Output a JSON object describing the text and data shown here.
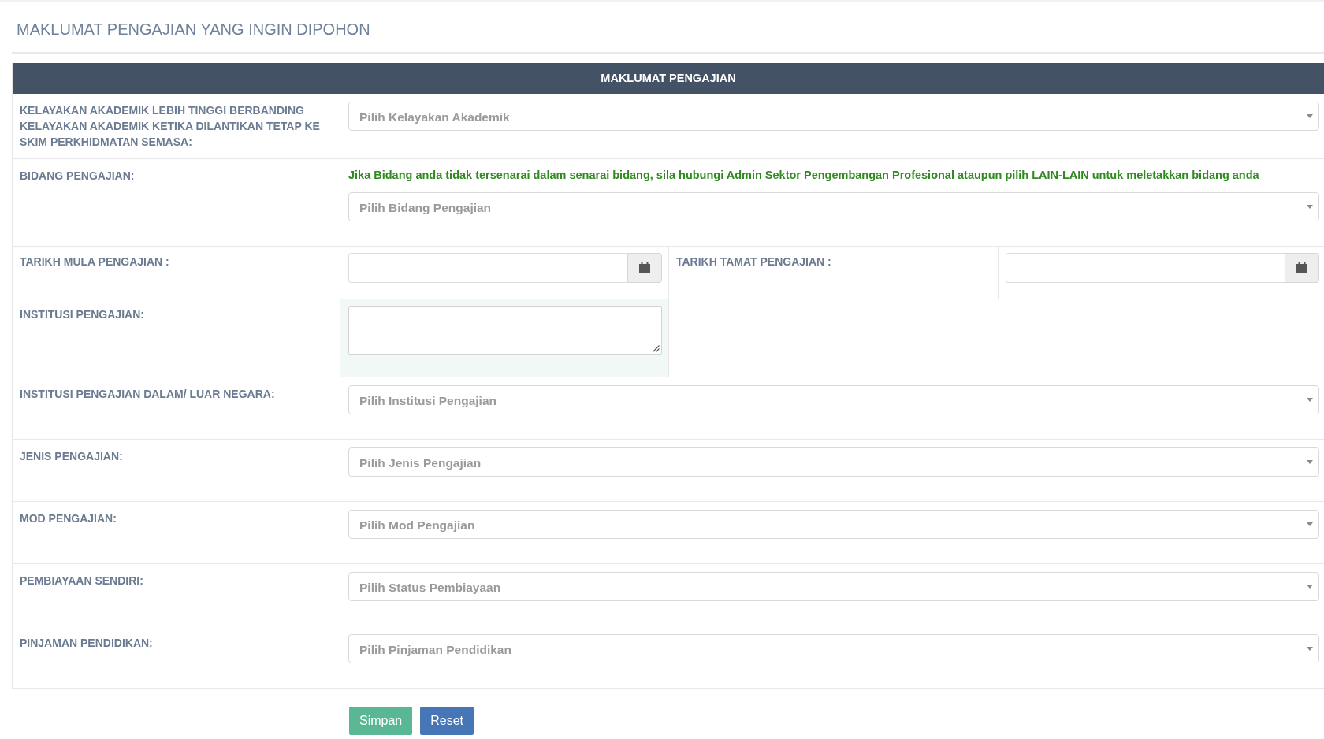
{
  "page_title": "MAKLUMAT PENGAJIAN YANG INGIN DIPOHON",
  "form": {
    "header": "MAKLUMAT PENGAJIAN",
    "rows": [
      {
        "kind": "select",
        "label": "KELAYAKAN AKADEMIK LEBIH TINGGI BERBANDING KELAYAKAN AKADEMIK KETIKA DILANTIKAN TETAP KE SKIM PERKHIDMATAN SEMASA:",
        "placeholder": "Pilih Kelayakan Akademik"
      },
      {
        "kind": "select",
        "label": "BIDANG PENGAJIAN:",
        "note": "Jika Bidang anda tidak tersenarai dalam senarai bidang, sila hubungi Admin Sektor Pengembangan Profesional ataupun pilih LAIN-LAIN untuk meletakkan bidang anda",
        "placeholder": "Pilih Bidang Pengajian"
      },
      {
        "kind": "dates",
        "fields": [
          {
            "label": "TARIKH MULA PENGAJIAN :"
          },
          {
            "label": "TARIKH TAMAT PENGAJIAN :"
          }
        ]
      },
      {
        "kind": "textarea",
        "label": "INSTITUSI PENGAJIAN:",
        "highlighted": true
      },
      {
        "kind": "select",
        "label": "INSTITUSI PENGAJIAN DALAM/ LUAR NEGARA:",
        "placeholder": "Pilih Institusi Pengajian"
      },
      {
        "kind": "select",
        "label": "JENIS PENGAJIAN:",
        "placeholder": "Pilih Jenis Pengajian"
      },
      {
        "kind": "select",
        "label": "MOD PENGAJIAN:",
        "placeholder": "Pilih Mod Pengajian"
      },
      {
        "kind": "select",
        "label": "PEMBIAYAAN SENDIRI:",
        "placeholder": "Pilih Status Pembiayaan"
      },
      {
        "kind": "select",
        "label": "PINJAMAN PENDIDIKAN:",
        "placeholder": "Pilih Pinjaman Pendidikan"
      }
    ]
  },
  "buttons": [
    {
      "label": "Simpan",
      "kind": "save"
    },
    {
      "label": "Reset",
      "kind": "reset"
    }
  ]
}
